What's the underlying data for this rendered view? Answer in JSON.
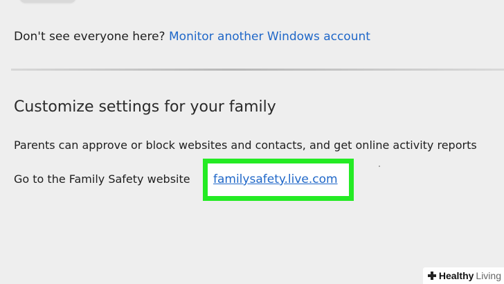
{
  "monitor_section": {
    "prompt": "Don't see everyone here?",
    "link_label": "Monitor another Windows account"
  },
  "customize_section": {
    "title": "Customize settings for your family",
    "description": "Parents can approve or block websites and contacts, and get online activity reports",
    "website_prompt": "Go to the Family Safety website",
    "website_link": "familysafety.live.com"
  },
  "watermark": {
    "icon": "plus-icon",
    "strong_text": "Healthy",
    "light_text": "Living"
  },
  "colors": {
    "background": "#eeeeee",
    "link": "#1f67c8",
    "highlight": "#24eb24"
  }
}
